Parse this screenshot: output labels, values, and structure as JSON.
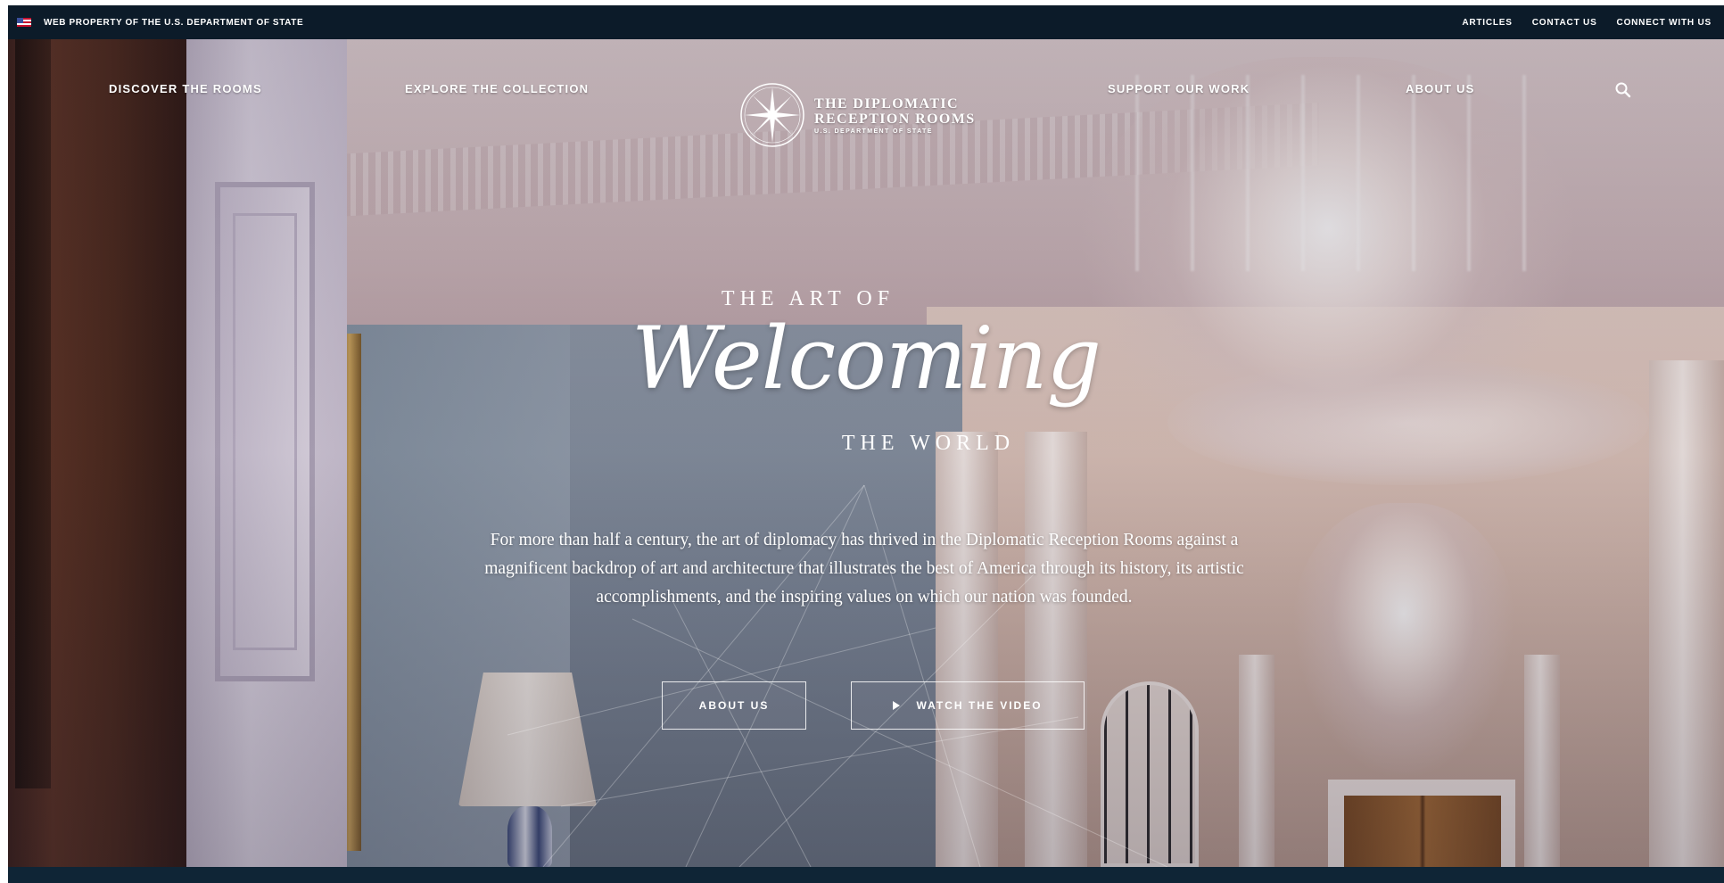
{
  "topbar": {
    "property_text": "WEB PROPERTY OF THE U.S. DEPARTMENT OF STATE",
    "links": [
      "ARTICLES",
      "CONTACT US",
      "CONNECT WITH US"
    ]
  },
  "nav": {
    "items": [
      "DISCOVER THE ROOMS",
      "EXPLORE THE COLLECTION",
      "SUPPORT OUR WORK",
      "ABOUT US"
    ],
    "logo": {
      "line1": "THE DIPLOMATIC",
      "line2": "RECEPTION ROOMS",
      "line3": "U.S. DEPARTMENT OF STATE"
    },
    "search_icon": "search-icon"
  },
  "hero": {
    "art_of": "THE ART OF",
    "headline": "Welcoming",
    "the_world": "THE WORLD",
    "description": "For more than half a century, the art of diplomacy has thrived in the Diplomatic Reception Rooms against a magnificent backdrop of art and architecture that illustrates the best of America through its history, its artistic accomplishments, and the inspiring values on which our nation was founded.",
    "buttons": {
      "about": "ABOUT US",
      "video": "WATCH THE VIDEO"
    }
  },
  "colors": {
    "topbar_bg": "#0c1b29",
    "bottom_bar_bg": "#0f2536",
    "text": "#ffffff"
  }
}
